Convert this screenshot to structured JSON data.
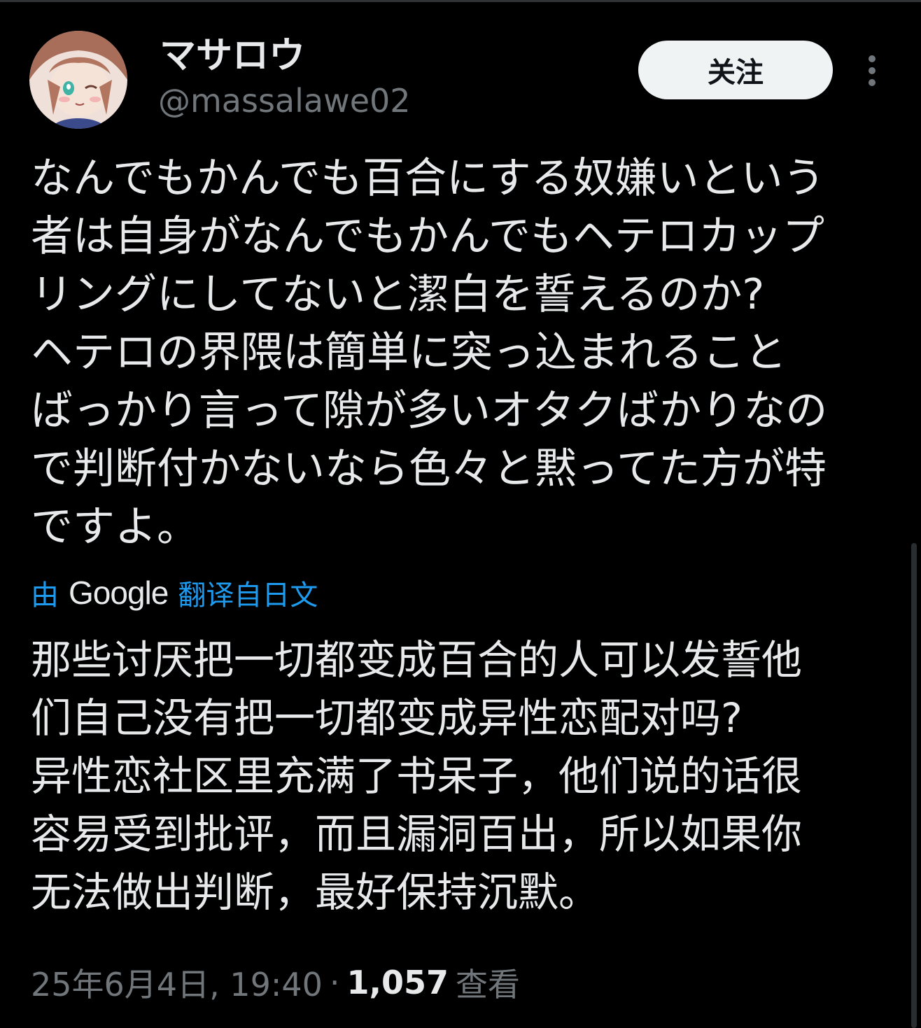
{
  "author": {
    "display_name": "マサロウ",
    "handle": "@massalawe02"
  },
  "actions": {
    "follow_label": "关注",
    "more_icon": "more-vertical-icon"
  },
  "tweet": {
    "lines": [
      "なんでもかんでも百合にする奴嫌いという",
      "者は自身がなんでもかんでもヘテロカップ",
      "リングにしてないと潔白を誓えるのか?",
      "ヘテロの界隈は簡単に突っ込まれること",
      "ばっかり言って隙が多いオタクばかりなの",
      "で判断付かないなら色々と黙ってた方が特",
      "ですよ。"
    ]
  },
  "translation": {
    "by": "由",
    "provider": "Google",
    "from": "翻译自日文",
    "lines": [
      "那些讨厌把一切都变成百合的人可以发誓他",
      "们自己没有把一切都变成异性恋配对吗?",
      "异性恋社区里充满了书呆子，他们说的话很",
      "容易受到批评，而且漏洞百出，所以如果你",
      "无法做出判断，最好保持沉默。"
    ]
  },
  "meta": {
    "timestamp": "25年6月4日, 19:40",
    "separator": "·",
    "views_count": "1,057",
    "views_label": "查看"
  },
  "colors": {
    "background": "#000000",
    "text": "#e7e9ea",
    "muted": "#71767b",
    "link": "#1d9bf0",
    "button_bg": "#eff3f4"
  }
}
